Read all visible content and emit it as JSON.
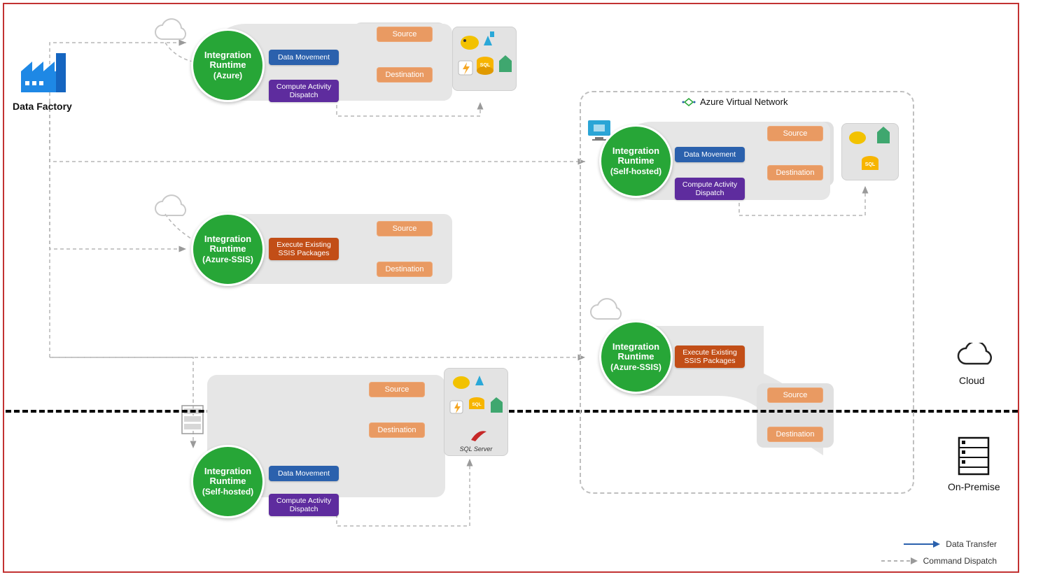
{
  "data_factory_label": "Data Factory",
  "ir": {
    "title": "Integration Runtime",
    "azure": "(Azure)",
    "ssis": "(Azure-SSIS)",
    "self": "(Self-hosted)"
  },
  "pills": {
    "data_movement": "Data Movement",
    "compute_activity": "Compute Activity",
    "dispatch": "Dispatch",
    "exec_existing": "Execute Existing",
    "ssis_packages": "SSIS Packages"
  },
  "boxes": {
    "source": "Source",
    "destination": "Destination"
  },
  "vnet_label": "Azure Virtual Network",
  "sql_server_label": "SQL Server",
  "side": {
    "cloud": "Cloud",
    "onprem": "On-Premise"
  },
  "legend": {
    "data_transfer": "Data Transfer",
    "command_dispatch": "Command Dispatch"
  },
  "icons": {
    "factory": "factory-icon",
    "cloud": "cloud-icon",
    "monitor": "monitor-icon",
    "server_rack": "server-rack-icon",
    "sql": "sql-icon",
    "hadoop": "hadoop-elephant-icon",
    "flask": "flask-icon",
    "lightning": "lightning-icon",
    "dw": "data-warehouse-icon",
    "vnet_diamond": "vnet-diamond-icon",
    "server_onprem": "onprem-server-icon"
  }
}
